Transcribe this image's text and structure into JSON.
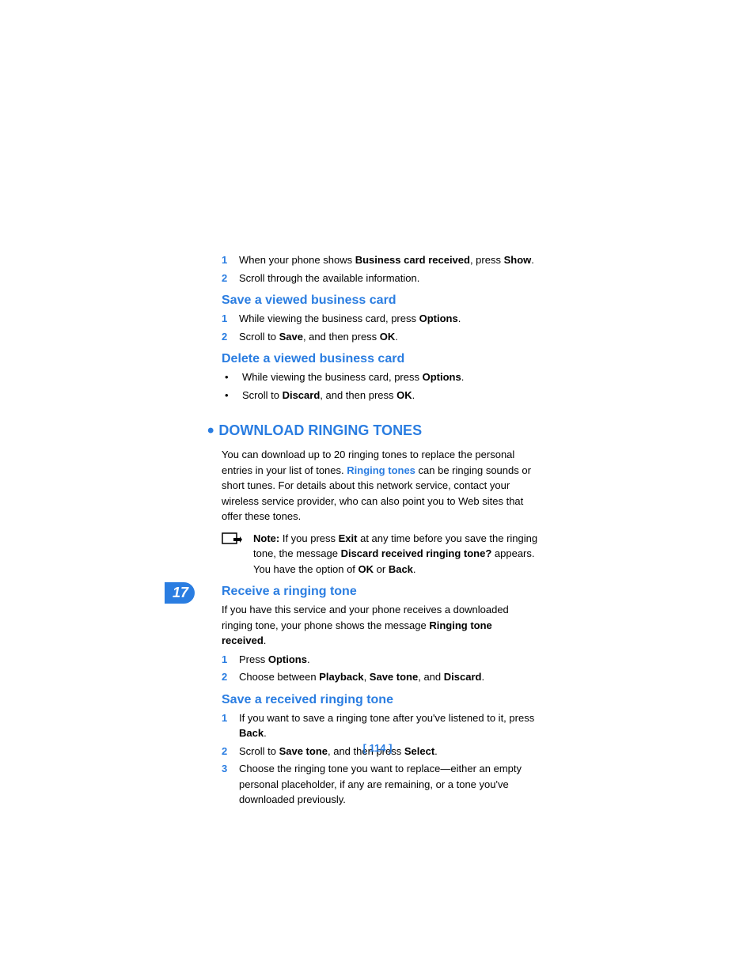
{
  "chapter_tab": "17",
  "page_number": "[ 114 ]",
  "intro_steps": [
    {
      "n": "1",
      "parts": [
        "When your phone shows ",
        "Business card received",
        ", press ",
        "Show",
        "."
      ]
    },
    {
      "n": "2",
      "parts": [
        "Scroll through the available information."
      ]
    }
  ],
  "save_card": {
    "heading": "Save a viewed business card",
    "steps": [
      {
        "n": "1",
        "parts": [
          "While viewing the business card, press ",
          "Options",
          "."
        ]
      },
      {
        "n": "2",
        "parts": [
          "Scroll to ",
          "Save",
          ", and then press ",
          "OK",
          "."
        ]
      }
    ]
  },
  "delete_card": {
    "heading": "Delete a viewed business card",
    "bullets": [
      {
        "parts": [
          "While viewing the business card, press ",
          "Options",
          "."
        ]
      },
      {
        "parts": [
          "Scroll to ",
          "Discard",
          ", and then press ",
          "OK",
          "."
        ]
      }
    ]
  },
  "download": {
    "heading": "DOWNLOAD RINGING TONES",
    "para_pre": "You can download up to 20 ringing tones to replace the personal entries in your list of tones. ",
    "para_link": "Ringing tones",
    "para_post": " can be ringing sounds or short tunes. For details about this network service, contact your wireless service provider, who can also point you to Web sites that offer these tones.",
    "note": {
      "label": "Note:",
      "parts": [
        " If you press ",
        "Exit",
        " at any time before you save the ringing tone, the message ",
        "Discard received ringing tone?",
        " appears. You have the option of ",
        "OK",
        " or ",
        "Back",
        "."
      ]
    }
  },
  "receive": {
    "heading": "Receive a ringing tone",
    "para_pre": "If you have this service and your phone receives a downloaded ringing tone, your phone shows the message ",
    "para_bold": "Ringing tone received",
    "para_post": ".",
    "steps": [
      {
        "n": "1",
        "parts": [
          "Press ",
          "Options",
          "."
        ]
      },
      {
        "n": "2",
        "parts": [
          "Choose between ",
          "Playback",
          ", ",
          "Save tone",
          ", and ",
          "Discard",
          "."
        ]
      }
    ]
  },
  "save_tone": {
    "heading": "Save a received ringing tone",
    "steps": [
      {
        "n": "1",
        "parts": [
          "If you want to save a ringing tone after you've listened to it, press ",
          "Back",
          "."
        ]
      },
      {
        "n": "2",
        "parts": [
          "Scroll to ",
          "Save tone",
          ", and then press ",
          "Select",
          "."
        ]
      },
      {
        "n": "3",
        "parts": [
          "Choose the ringing tone you want to replace—either an empty personal placeholder, if any are remaining, or a tone you've downloaded previously."
        ]
      }
    ]
  }
}
